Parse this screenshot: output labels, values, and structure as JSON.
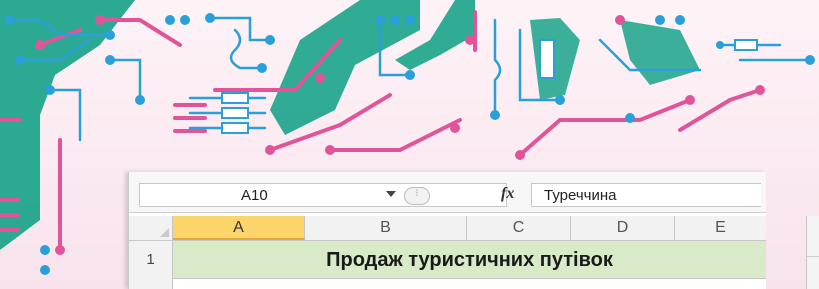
{
  "formula_bar": {
    "cell_reference": "A10",
    "function_icon": "fx",
    "formula_value": "Туреччина"
  },
  "columns": [
    "A",
    "B",
    "C",
    "D",
    "E"
  ],
  "active_column": "A",
  "rows": [
    {
      "number": "1",
      "merged_title": "Продаж туристичних путівок"
    }
  ],
  "colors": {
    "accent_teal": "#1aa389",
    "accent_pink": "#e0559a",
    "accent_blue": "#2a9fd9",
    "title_fill": "#d9eac8",
    "active_header": "#fbd46a"
  }
}
